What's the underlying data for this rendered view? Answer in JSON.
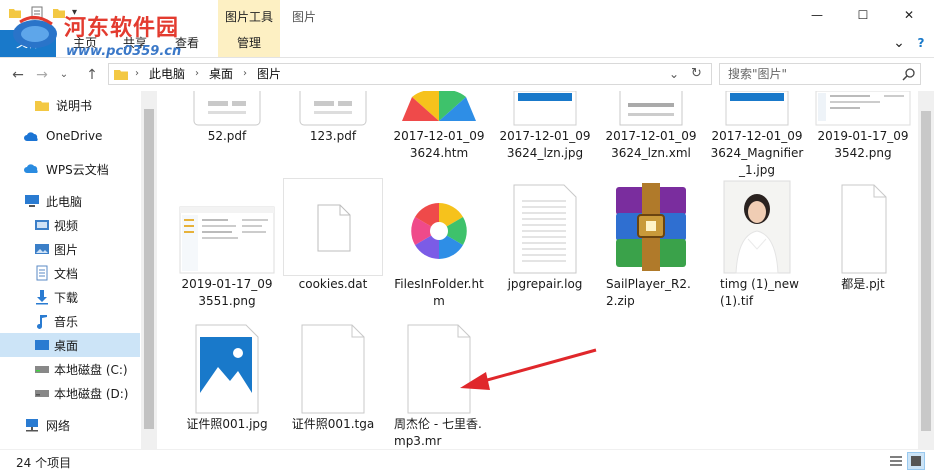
{
  "window": {
    "title": "图片",
    "picture_tools": "图片工具",
    "minimize": "—",
    "maximize": "☐",
    "close": "✕"
  },
  "ribbon": {
    "tabs": [
      {
        "label": "文件"
      },
      {
        "label": "主页"
      },
      {
        "label": "共享"
      },
      {
        "label": "查看"
      },
      {
        "label": "管理"
      }
    ],
    "collapse": "⌄",
    "help": "?"
  },
  "watermark": {
    "title": "河东软件园",
    "url": "www.pc0359.cn"
  },
  "address": {
    "crumbs": [
      "此电脑",
      "桌面",
      "图片"
    ],
    "refresh": "↻",
    "dropdown": "⌄"
  },
  "search": {
    "placeholder": "搜索\"图片\"",
    "icon": "search-icon"
  },
  "sidebar": {
    "items": [
      {
        "label": "说明书",
        "icon": "folder-icon"
      },
      {
        "label": "OneDrive",
        "icon": "cloud-icon"
      },
      {
        "label": "WPS云文档",
        "icon": "cloud-icon"
      },
      {
        "label": "此电脑",
        "icon": "computer-icon"
      },
      {
        "label": "视频",
        "icon": "video-icon"
      },
      {
        "label": "图片",
        "icon": "picture-icon"
      },
      {
        "label": "文档",
        "icon": "document-icon"
      },
      {
        "label": "下载",
        "icon": "download-icon"
      },
      {
        "label": "音乐",
        "icon": "music-icon"
      },
      {
        "label": "桌面",
        "icon": "desktop-icon"
      },
      {
        "label": "本地磁盘 (C:)",
        "icon": "drive-icon"
      },
      {
        "label": "本地磁盘 (D:)",
        "icon": "drive-icon"
      },
      {
        "label": "网络",
        "icon": "network-icon"
      }
    ]
  },
  "files": [
    {
      "name": "52.pdf",
      "icon": "pdf-icon"
    },
    {
      "name": "123.pdf",
      "icon": "pdf-icon"
    },
    {
      "name": "2017-12-01_093624.htm",
      "icon": "browser-icon"
    },
    {
      "name": "2017-12-01_093624_lzn.jpg",
      "icon": "image-icon"
    },
    {
      "name": "2017-12-01_093624_lzn.xml",
      "icon": "xml-icon"
    },
    {
      "name": "2017-12-01_093624_Magnifier_1.jpg",
      "icon": "image-icon"
    },
    {
      "name": "2019-01-17_093542.png",
      "icon": "screenshot-icon"
    },
    {
      "name": "2019-01-17_093551.png",
      "icon": "screenshot-icon"
    },
    {
      "name": "cookies.dat",
      "icon": "blank-file-icon"
    },
    {
      "name": "FilesInFolder.htm",
      "icon": "browser-icon"
    },
    {
      "name": "jpgrepair.log",
      "icon": "text-file-icon"
    },
    {
      "name": "SailPlayer_R2.2.zip",
      "icon": "winrar-icon"
    },
    {
      "name": "timg (1)_new(1).tif",
      "icon": "photo-icon"
    },
    {
      "name": "都是.pjt",
      "icon": "blank-file-icon"
    },
    {
      "name": "证件照001.jpg",
      "icon": "photos-app-icon"
    },
    {
      "name": "证件照001.tga",
      "icon": "blank-file-icon"
    },
    {
      "name": "周杰伦 - 七里香.mp3.mr",
      "icon": "blank-file-icon"
    }
  ],
  "status": {
    "count": "24 个项目"
  },
  "colors": {
    "accent": "#1979ca",
    "picture_tools": "#fdf0c3",
    "selection": "#cce4f7",
    "annotation_arrow": "#e0272b"
  }
}
